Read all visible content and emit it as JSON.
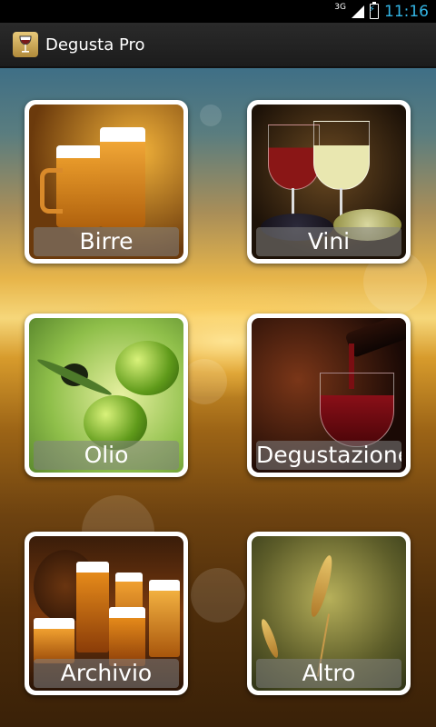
{
  "status_bar": {
    "network": "3G",
    "time": "11:16"
  },
  "action_bar": {
    "title": "Degusta Pro",
    "icon": "wine-glass-icon"
  },
  "tiles": [
    {
      "label": "Birre",
      "image": "beer-mugs"
    },
    {
      "label": "Vini",
      "image": "wine-glasses"
    },
    {
      "label": "Olio",
      "image": "olives"
    },
    {
      "label": "Degustazione",
      "image": "wine-pour"
    },
    {
      "label": "Archivio",
      "image": "beer-collection"
    },
    {
      "label": "Altro",
      "image": "wheat"
    }
  ],
  "colors": {
    "accent": "#33b5e5",
    "action_bar": "#222222",
    "tile_border": "#ffffff"
  }
}
